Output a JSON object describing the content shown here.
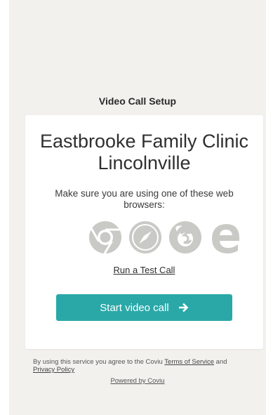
{
  "page": {
    "title": "Video Call Setup"
  },
  "card": {
    "clinic_name": "Eastbrooke Family Clinic Lincolnville",
    "browser_message": "Make sure you are using one of these web browsers:",
    "browsers": [
      "chrome-icon",
      "safari-icon",
      "firefox-icon",
      "edge-icon"
    ],
    "test_call_link": "Run a Test Call",
    "start_button": "Start video call"
  },
  "footer": {
    "agree_prefix": "By using this service you agree to the Coviu ",
    "terms_link": "Terms of Service",
    "and_text": " and ",
    "privacy_link": "Privacy Policy",
    "powered_by": "Powered by Coviu"
  },
  "colors": {
    "accent": "#2aa8a8",
    "background": "#f3f1ee",
    "icon_gray": "#c9c9c6"
  }
}
